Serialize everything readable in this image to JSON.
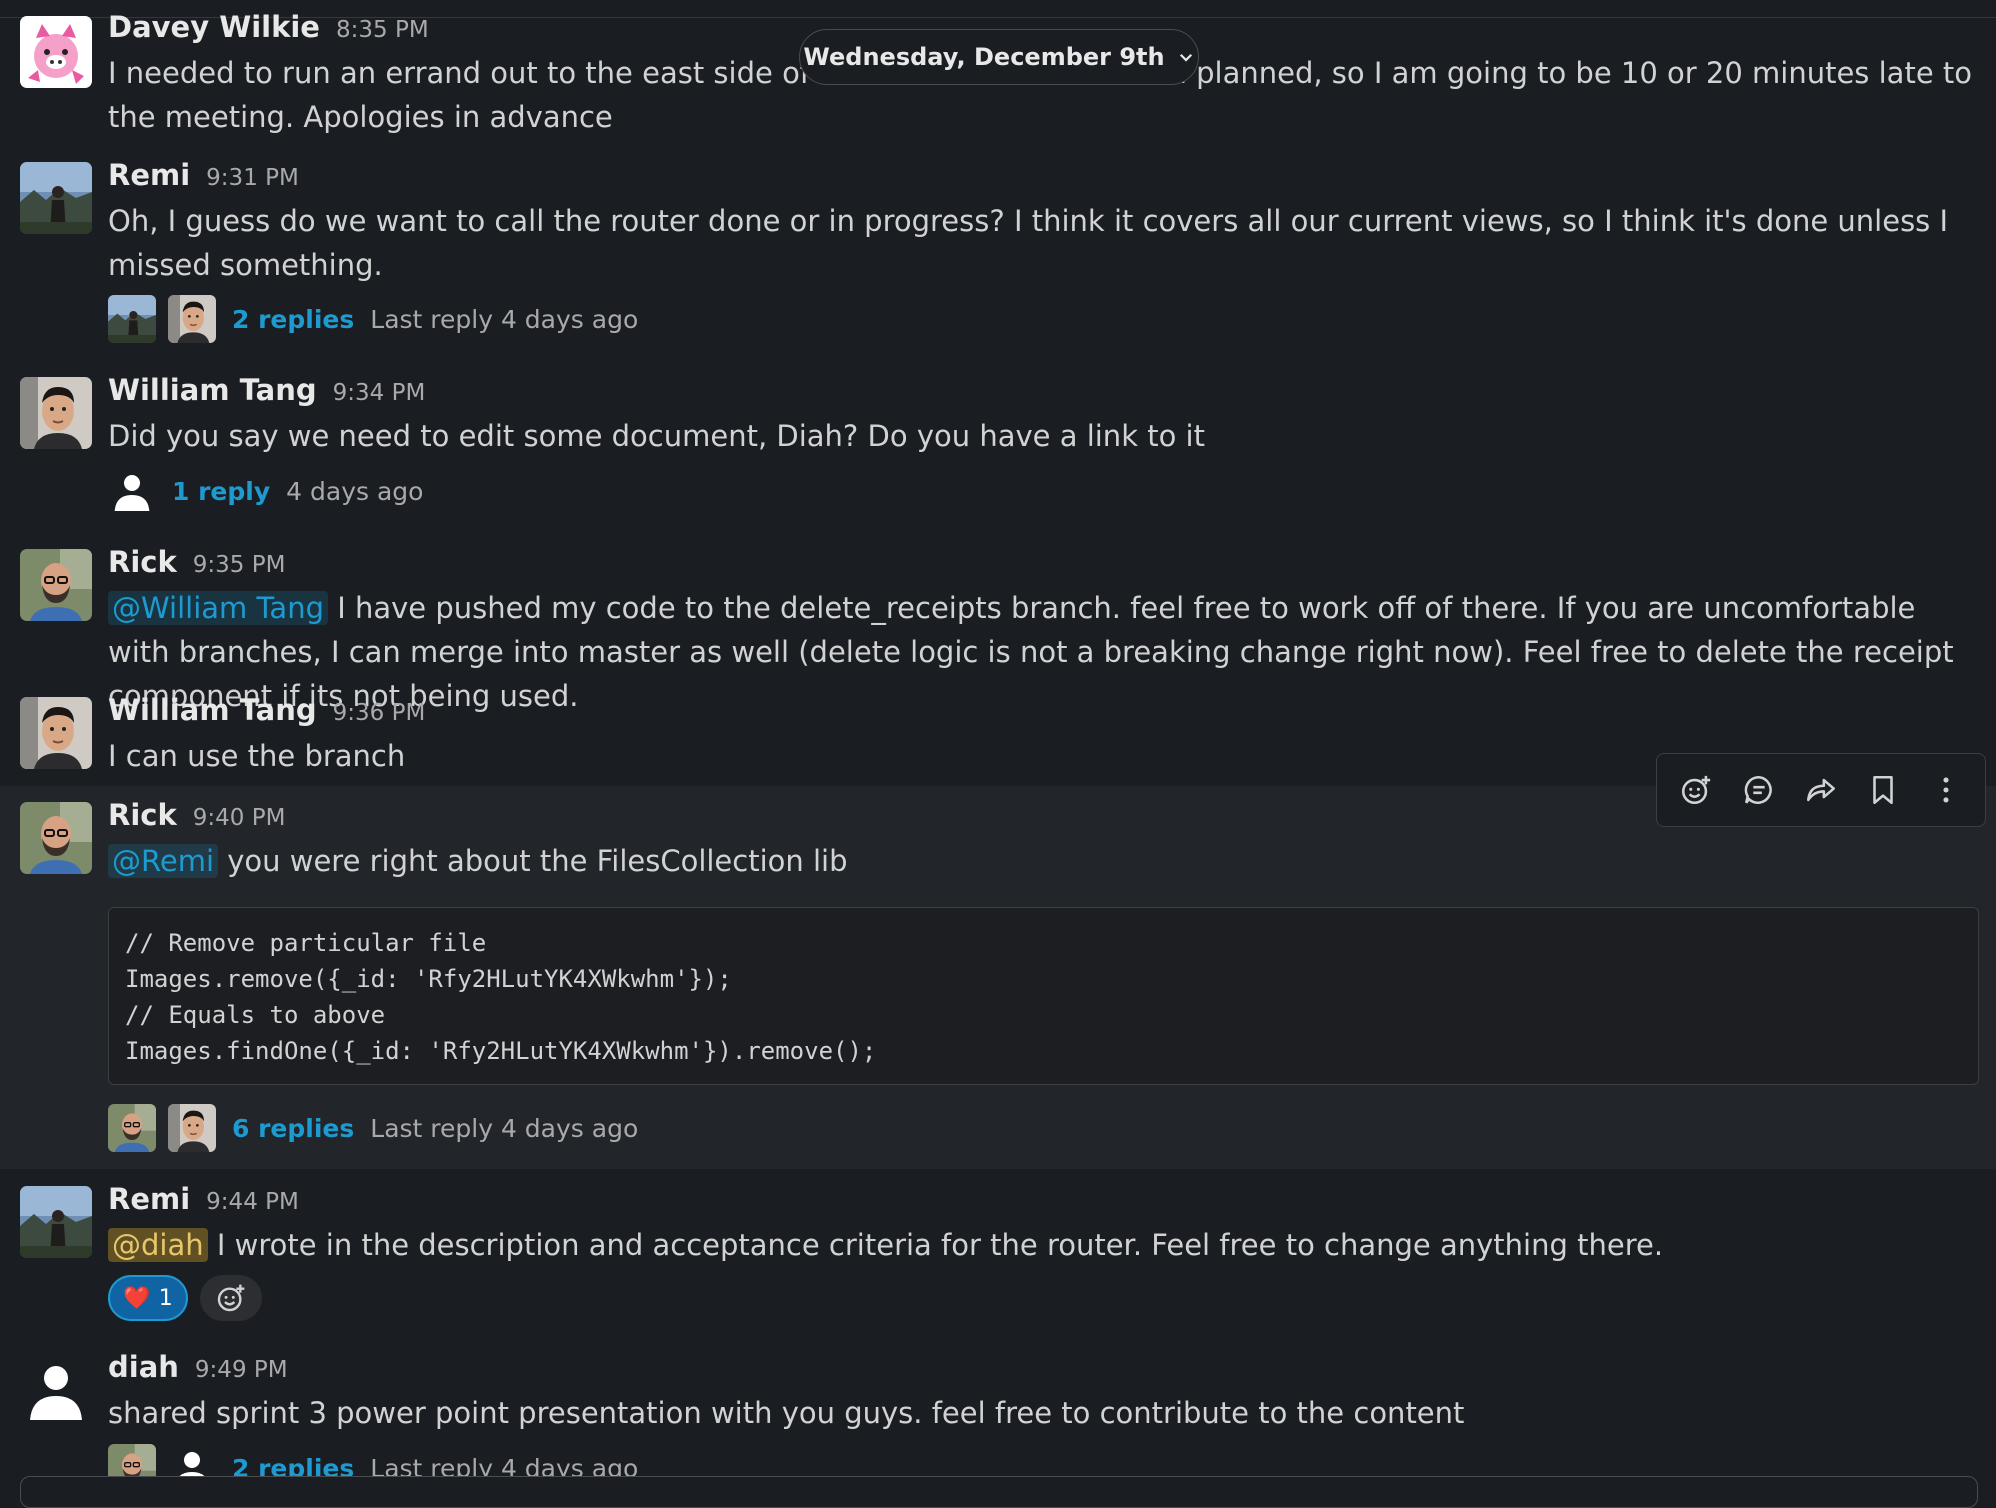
{
  "date_divider": "Wednesday, December 9th",
  "messages": [
    {
      "author": "Davey Wilkie",
      "time": "8:35 PM",
      "line1": "I needed to run an errand out to the east side of the i",
      "line1b": "than planned, so I am going to be 10 or 20 minutes late to",
      "line2": "the meeting. Apologies in advance"
    },
    {
      "author": "Remi",
      "time": "9:31 PM",
      "text": "Oh, I guess do we want to call the router done or in progress? I think it covers all our current views, so I think it's done unless I missed something.",
      "thread": {
        "replies": "2 replies",
        "last": "Last reply 4 days ago"
      }
    },
    {
      "author": "William Tang",
      "time": "9:34 PM",
      "text": "Did you say we need to edit some document, Diah? Do you have a link to it",
      "thread": {
        "replies": "1 reply",
        "last": "4 days ago"
      }
    },
    {
      "author": "Rick",
      "time": "9:35 PM",
      "mention": "@William Tang",
      "text": " I have pushed my code to the delete_receipts branch. feel free to work off of there. If you are uncomfortable with branches, I can merge into master as well (delete logic is not a breaking change right now). Feel free to delete the receipt component if its not being used."
    },
    {
      "author": "William Tang",
      "time": "9:36 PM",
      "text": "I can use the branch"
    },
    {
      "author": "Rick",
      "time": "9:40 PM",
      "mention": "@Remi",
      "text": " you were right about the FilesCollection lib",
      "code": "// Remove particular file\nImages.remove({_id: 'Rfy2HLutYK4XWkwhm'});\n// Equals to above\nImages.findOne({_id: 'Rfy2HLutYK4XWkwhm'}).remove();",
      "thread": {
        "replies": "6 replies",
        "last": "Last reply 4 days ago"
      }
    },
    {
      "author": "Remi",
      "time": "9:44 PM",
      "mention": "@diah",
      "text": " I wrote in the description and acceptance criteria for the router. Feel free to change anything there.",
      "reaction": {
        "emoji": "❤️",
        "count": "1"
      }
    },
    {
      "author": "diah",
      "time": "9:49 PM",
      "text": "shared sprint 3 power point presentation with you guys. feel free to contribute to the content",
      "thread": {
        "replies": "2 replies",
        "last": "Last reply 4 days ago"
      }
    }
  ],
  "toolbar_icons": [
    "add-reaction-icon",
    "reply-in-thread-icon",
    "share-icon",
    "bookmark-icon",
    "more-actions-icon"
  ],
  "colors": {
    "background": "#1a1d21",
    "link": "#1d9bd1",
    "hover_row": "#222529"
  }
}
